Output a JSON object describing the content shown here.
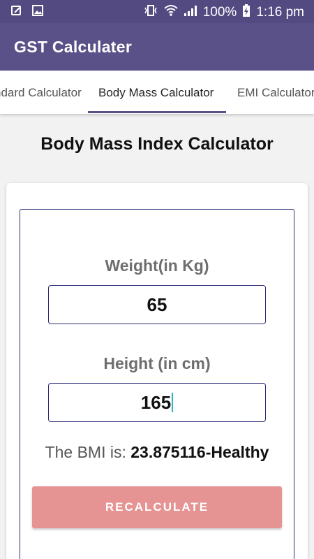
{
  "status_bar": {
    "battery": "100%",
    "time": "1:16 pm"
  },
  "app_bar": {
    "title": "GST Calculater"
  },
  "tabs": [
    {
      "label": "ndard Calculator"
    },
    {
      "label": "Body Mass Calculator"
    },
    {
      "label": "EMI Calculator"
    }
  ],
  "main": {
    "heading": "Body Mass Index Calculator",
    "weight_label": "Weight(in Kg)",
    "weight_value": "65",
    "height_label": "Height (in cm)",
    "height_value": "165",
    "result_prefix": "The BMI is: ",
    "result_value": "23.875116-Healthy",
    "button_label": "RECALCULATE"
  },
  "colors": {
    "app_bar": "#5a5189",
    "status_bar": "#544a82",
    "button": "#e69393",
    "field_border": "#2c2c7a",
    "cursor": "#2ab4c6"
  }
}
